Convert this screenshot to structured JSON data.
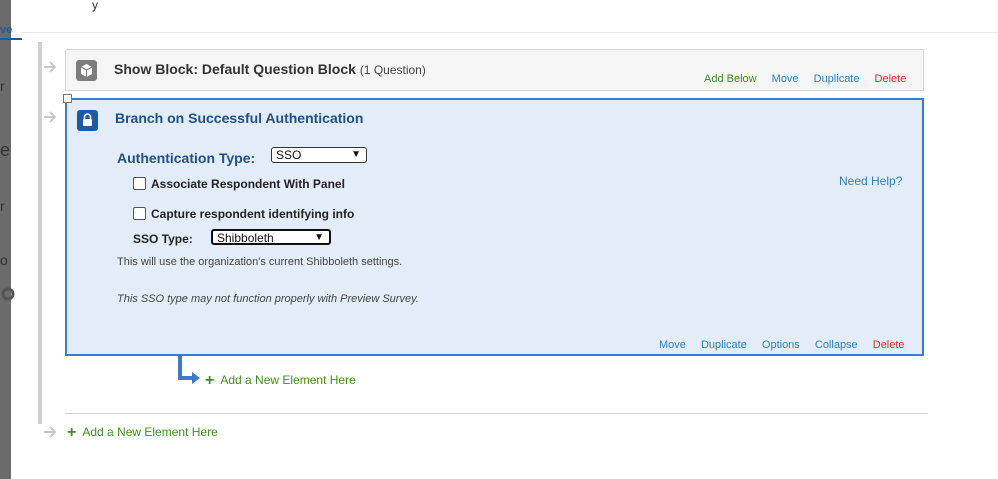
{
  "sidebar_fragments": {
    "tab": "ve",
    "f1": "r",
    "f2": "e",
    "f3": "r",
    "f4": "o"
  },
  "top_fragment": "y",
  "show_block": {
    "title": "Show Block: Default Question Block",
    "count": "(1 Question)",
    "actions": [
      "Add Below",
      "Move",
      "Duplicate",
      "Delete"
    ]
  },
  "branch": {
    "title": "Branch on Successful Authentication",
    "auth_type_label": "Authentication Type:",
    "auth_type_value": "SSO",
    "associate_panel_label": "Associate Respondent With Panel",
    "capture_info_label": "Capture respondent identifying info",
    "need_help": "Need Help?",
    "sso_type_label": "SSO Type:",
    "sso_type_value": "Shibboleth",
    "info_text": "This will use the organization's current Shibboleth settings.",
    "warning_text": "This SSO type may not function properly with Preview Survey.",
    "actions": [
      "Move",
      "Duplicate",
      "Options",
      "Collapse",
      "Delete"
    ]
  },
  "add_element_label": "Add a New Element Here",
  "icons": {
    "block": "cube-icon",
    "branch": "lock-icon",
    "connector": "arrow-right-icon"
  },
  "colors": {
    "accent_blue": "#3d7bd1",
    "action_blue": "#2d7fc0",
    "add_green": "#3f8f1f",
    "delete_red": "#d0312d"
  }
}
